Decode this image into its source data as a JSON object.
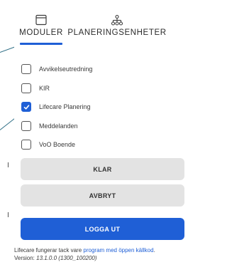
{
  "tabs": [
    {
      "label": "MODULER",
      "icon": "window-icon",
      "active": true
    },
    {
      "label": "PLANERINGSENHETER",
      "icon": "org-chart-icon",
      "active": false
    }
  ],
  "options": [
    {
      "label": "Avvikelseutredning",
      "checked": false
    },
    {
      "label": "KIR",
      "checked": false
    },
    {
      "label": "Lifecare Planering",
      "checked": true
    },
    {
      "label": "Meddelanden",
      "checked": false
    },
    {
      "label": "VoO Boende",
      "checked": false
    }
  ],
  "buttons": {
    "klar": "KLAR",
    "avbryt": "AVBRYT",
    "logout": "LOGGA UT"
  },
  "footer": {
    "text_before": "Lifecare fungerar tack vare ",
    "link": "program med öppen källkod",
    "text_after": ".",
    "version_label": "Version: ",
    "version_value": "13.1.0.0 (1300_100200)"
  },
  "colors": {
    "accent": "#1f5fd6",
    "button_bg": "#e3e3e3"
  }
}
